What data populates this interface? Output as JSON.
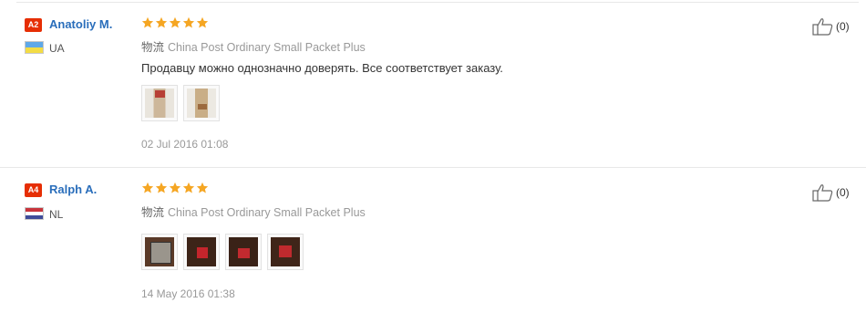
{
  "reviews": [
    {
      "level": "A2",
      "name": "Anatoliy M.",
      "country_code": "UA",
      "stars": 5,
      "shipping_label": "物流",
      "shipping_method": "China Post Ordinary Small Packet Plus",
      "feedback": "Продавцу можно однозначно доверять. Все соответствует заказу.",
      "photo_count": 2,
      "date": "02 Jul 2016 01:08",
      "helpful_count": "(0)"
    },
    {
      "level": "A4",
      "name": "Ralph A.",
      "country_code": "NL",
      "stars": 5,
      "shipping_label": "物流",
      "shipping_method": "China Post Ordinary Small Packet Plus",
      "feedback": "",
      "photo_count": 4,
      "date": "14 May 2016 01:38",
      "helpful_count": "(0)"
    }
  ],
  "colors": {
    "star": "#f5a623",
    "badge": "#e62e04",
    "name_link": "#2a6ebb",
    "muted_text": "#999999"
  },
  "icons": {
    "star": "star-icon",
    "thumbs_up": "thumbs-up-icon"
  }
}
